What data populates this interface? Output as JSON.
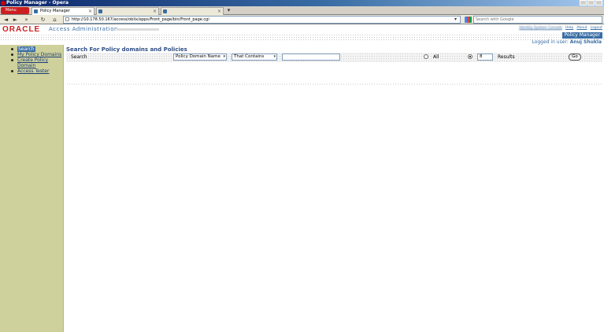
{
  "window": {
    "title": "Policy Manager - Opera"
  },
  "browser": {
    "menu_label": "Menu",
    "tabs": [
      {
        "label": "Policy Manager",
        "active": true
      },
      {
        "label": "",
        "active": false
      },
      {
        "label": "",
        "active": false
      }
    ],
    "address": "http://10.178.50.167/access/oblix/apps/Front_page/bin/Front_page.cgi",
    "search_placeholder": "Search with Google"
  },
  "header": {
    "logo": "ORACLE",
    "app_title": "Access Administration",
    "global_links": [
      "Identity System Console",
      "Help",
      "About",
      "Logout"
    ],
    "app_tab": "Policy Manager",
    "logged_in_label": "Logged in user:",
    "user_name": "Anuj Shukla"
  },
  "sidebar": {
    "items": [
      {
        "label": "Search",
        "active": true
      },
      {
        "label": "My Policy Domains",
        "active": false
      },
      {
        "label": "Create Policy Domain",
        "active": false
      },
      {
        "label": "Access Tester",
        "active": false
      }
    ]
  },
  "main": {
    "page_title": "Search For Policy domains and Policies",
    "search_label": "Search",
    "field_select": "Policy Domain Name",
    "condition_select": "That Contains",
    "search_value": "",
    "radio_all_label": "All",
    "results_count": "8",
    "results_label": "Results",
    "go_label": "Go"
  },
  "colors": {
    "oracle_red": "#cc1e1e",
    "accent_blue": "#3b6ea5",
    "sidebar_bg": "#ced19c"
  }
}
